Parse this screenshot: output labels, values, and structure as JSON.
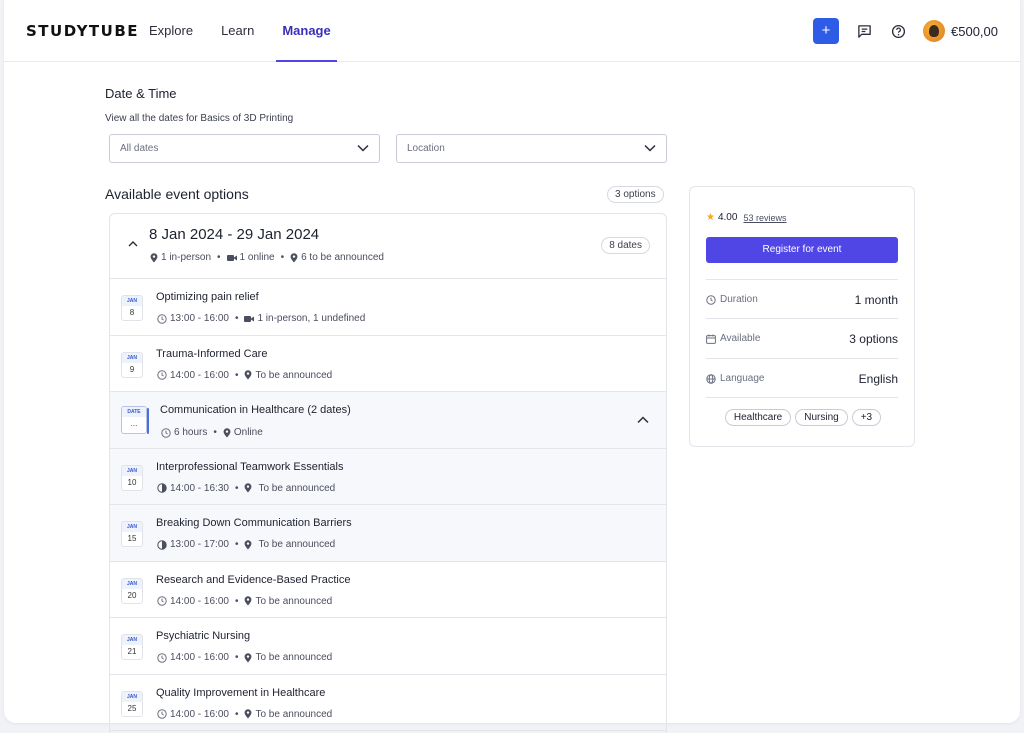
{
  "header": {
    "logo": "STUDYTUBE",
    "nav": [
      {
        "label": "Explore",
        "active": false
      },
      {
        "label": "Learn",
        "active": false
      },
      {
        "label": "Manage",
        "active": true
      }
    ],
    "add_label": "+",
    "balance": "€500,00",
    "icons": [
      "plus-icon",
      "chat-icon",
      "help-icon",
      "avatar"
    ]
  },
  "page": {
    "title": "Date & Time",
    "subtitle": "View all the dates for Basics of 3D Printing",
    "date_filter": "All dates",
    "location_filter": "Location",
    "section_title": "Available event options",
    "options_count": "3 options"
  },
  "group1": {
    "title": "8 Jan 2024 - 29 Jan 2024",
    "meta_inperson": "1 in-person",
    "meta_online": "1 online",
    "meta_tba": "6 to be announced",
    "dates_count": "8 dates"
  },
  "rows": [
    {
      "month": "JAN",
      "day": "8",
      "title": "Optimizing pain relief",
      "time": "13:00 - 16:00",
      "loc": "1 in-person, 1 undefined",
      "loc_icon": "video-icon",
      "time_icon": "clock-icon"
    },
    {
      "month": "JAN",
      "day": "9",
      "title": "Trauma-Informed Care",
      "time": "14:00 - 16:00",
      "loc": "To be announced",
      "loc_icon": "pin-icon",
      "time_icon": "clock-icon"
    }
  ],
  "group2": {
    "month": "DATE",
    "day": "...",
    "title": "Communication in Healthcare (2 dates)",
    "duration": "6 hours",
    "loc": "Online"
  },
  "subrows": [
    {
      "month": "JAN",
      "day": "10",
      "title": "Interprofessional Teamwork Essentials",
      "time": "14:00 - 16:30",
      "loc": "To be announced"
    },
    {
      "month": "JAN",
      "day": "15",
      "title": "Breaking Down Communication Barriers",
      "time": "13:00 - 17:00",
      "loc": "To be announced"
    }
  ],
  "rows2": [
    {
      "month": "JAN",
      "day": "20",
      "title": "Research and Evidence-Based Practice",
      "time": "14:00 - 16:00",
      "loc": "To be announced"
    },
    {
      "month": "JAN",
      "day": "21",
      "title": "Psychiatric Nursing",
      "time": "14:00 - 16:00",
      "loc": "To be announced"
    },
    {
      "month": "JAN",
      "day": "25",
      "title": "Quality Improvement in Healthcare",
      "time": "14:00 - 16:00",
      "loc": "To be announced"
    }
  ],
  "card": {
    "rating": "4.00",
    "reviews": "53 reviews",
    "register": "Register for event",
    "duration_label": "Duration",
    "duration_value": "1 month",
    "available_label": "Available",
    "available_value": "3 options",
    "language_label": "Language",
    "language_value": "English",
    "tags": [
      "Healthcare",
      "Nursing",
      "+3"
    ]
  },
  "colors": {
    "accent": "#4f46e5",
    "primary_button": "#2e5ce6",
    "star": "#f5a623"
  }
}
